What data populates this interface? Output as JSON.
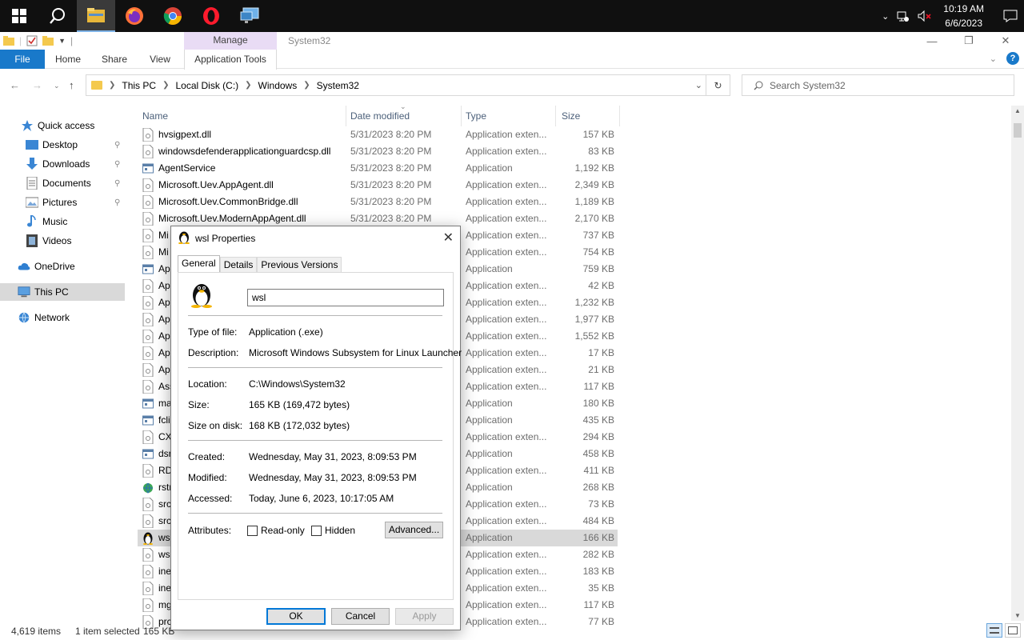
{
  "taskbar": {
    "clock_time": "10:19 AM",
    "clock_date": "6/6/2023",
    "apps": [
      "start-icon",
      "search-icon",
      "file-explorer-icon",
      "firefox-icon",
      "chrome-icon",
      "opera-icon",
      "remote-desktop-icon"
    ]
  },
  "explorer": {
    "context_tab": "Manage",
    "title": "System32",
    "ribbon_tabs": {
      "file": "File",
      "home": "Home",
      "share": "Share",
      "view": "View",
      "app_tools": "Application Tools"
    },
    "breadcrumb": [
      "This PC",
      "Local Disk (C:)",
      "Windows",
      "System32"
    ],
    "search_placeholder": "Search System32",
    "columns": {
      "name": "Name",
      "date": "Date modified",
      "type": "Type",
      "size": "Size"
    },
    "nav": {
      "quick_access": "Quick access",
      "desktop": "Desktop",
      "downloads": "Downloads",
      "documents": "Documents",
      "pictures": "Pictures",
      "music": "Music",
      "videos": "Videos",
      "onedrive": "OneDrive",
      "this_pc": "This PC",
      "network": "Network"
    },
    "files": [
      {
        "name": "hvsigpext.dll",
        "date": "5/31/2023 8:20 PM",
        "type": "Application exten...",
        "size": "157 KB",
        "icon": "dll"
      },
      {
        "name": "windowsdefenderapplicationguardcsp.dll",
        "date": "5/31/2023 8:20 PM",
        "type": "Application exten...",
        "size": "83 KB",
        "icon": "dll"
      },
      {
        "name": "AgentService",
        "date": "5/31/2023 8:20 PM",
        "type": "Application",
        "size": "1,192 KB",
        "icon": "exe"
      },
      {
        "name": "Microsoft.Uev.AppAgent.dll",
        "date": "5/31/2023 8:20 PM",
        "type": "Application exten...",
        "size": "2,349 KB",
        "icon": "dll"
      },
      {
        "name": "Microsoft.Uev.CommonBridge.dll",
        "date": "5/31/2023 8:20 PM",
        "type": "Application exten...",
        "size": "1,189 KB",
        "icon": "dll"
      },
      {
        "name": "Microsoft.Uev.ModernAppAgent.dll",
        "date": "5/31/2023 8:20 PM",
        "type": "Application exten...",
        "size": "2,170 KB",
        "icon": "dll"
      },
      {
        "name": "Mi",
        "date": "",
        "type": "Application exten...",
        "size": "737 KB",
        "icon": "dll"
      },
      {
        "name": "Mi",
        "date": "",
        "type": "Application exten...",
        "size": "754 KB",
        "icon": "dll"
      },
      {
        "name": "Ap",
        "date": "",
        "type": "Application",
        "size": "759 KB",
        "icon": "exe"
      },
      {
        "name": "Ap",
        "date": "",
        "type": "Application exten...",
        "size": "42 KB",
        "icon": "dll"
      },
      {
        "name": "Ap",
        "date": "",
        "type": "Application exten...",
        "size": "1,232 KB",
        "icon": "dll"
      },
      {
        "name": "Ap",
        "date": "",
        "type": "Application exten...",
        "size": "1,977 KB",
        "icon": "dll"
      },
      {
        "name": "Ap",
        "date": "",
        "type": "Application exten...",
        "size": "1,552 KB",
        "icon": "dll"
      },
      {
        "name": "Ap",
        "date": "",
        "type": "Application exten...",
        "size": "17 KB",
        "icon": "dll"
      },
      {
        "name": "Ap",
        "date": "",
        "type": "Application exten...",
        "size": "21 KB",
        "icon": "dll"
      },
      {
        "name": "Ass",
        "date": "",
        "type": "Application exten...",
        "size": "117 KB",
        "icon": "dll"
      },
      {
        "name": "ma",
        "date": "",
        "type": "Application",
        "size": "180 KB",
        "icon": "exe"
      },
      {
        "name": "fcli",
        "date": "",
        "type": "Application",
        "size": "435 KB",
        "icon": "exe"
      },
      {
        "name": "CX",
        "date": "",
        "type": "Application exten...",
        "size": "294 KB",
        "icon": "dll"
      },
      {
        "name": "dsr",
        "date": "",
        "type": "Application",
        "size": "458 KB",
        "icon": "exe"
      },
      {
        "name": "RD",
        "date": "",
        "type": "Application exten...",
        "size": "411 KB",
        "icon": "dll"
      },
      {
        "name": "rstr",
        "date": "",
        "type": "Application",
        "size": "268 KB",
        "icon": "globe"
      },
      {
        "name": "src",
        "date": "",
        "type": "Application exten...",
        "size": "73 KB",
        "icon": "dll"
      },
      {
        "name": "src",
        "date": "",
        "type": "Application exten...",
        "size": "484 KB",
        "icon": "dll"
      },
      {
        "name": "ws",
        "date": "",
        "type": "Application",
        "size": "166 KB",
        "icon": "penguin"
      },
      {
        "name": "ws",
        "date": "",
        "type": "Application exten...",
        "size": "282 KB",
        "icon": "dll"
      },
      {
        "name": "ine",
        "date": "",
        "type": "Application exten...",
        "size": "183 KB",
        "icon": "dll"
      },
      {
        "name": "ine",
        "date": "",
        "type": "Application exten...",
        "size": "35 KB",
        "icon": "dll"
      },
      {
        "name": "mg",
        "date": "",
        "type": "Application exten...",
        "size": "117 KB",
        "icon": "dll"
      },
      {
        "name": "prc",
        "date": "",
        "type": "Application exten...",
        "size": "77 KB",
        "icon": "dll"
      }
    ],
    "status": {
      "count": "4,619 items",
      "selected": "1 item selected",
      "size": "165 KB"
    }
  },
  "dialog": {
    "title": "wsl Properties",
    "tabs": [
      "General",
      "Details",
      "Previous Versions"
    ],
    "name_value": "wsl",
    "props": {
      "type_label": "Type of file:",
      "type_value": "Application (.exe)",
      "desc_label": "Description:",
      "desc_value": "Microsoft Windows Subsystem for Linux Launcher",
      "loc_label": "Location:",
      "loc_value": "C:\\Windows\\System32",
      "size_label": "Size:",
      "size_value": "165 KB (169,472 bytes)",
      "disk_label": "Size on disk:",
      "disk_value": "168 KB (172,032 bytes)",
      "created_label": "Created:",
      "created_value": "Wednesday, May 31, 2023, 8:09:53 PM",
      "modified_label": "Modified:",
      "modified_value": "Wednesday, May 31, 2023, 8:09:53 PM",
      "accessed_label": "Accessed:",
      "accessed_value": "Today, June 6, 2023, 10:17:05 AM",
      "attr_label": "Attributes:",
      "readonly_label": "Read-only",
      "hidden_label": "Hidden",
      "advanced_label": "Advanced..."
    },
    "buttons": {
      "ok": "OK",
      "cancel": "Cancel",
      "apply": "Apply"
    }
  }
}
